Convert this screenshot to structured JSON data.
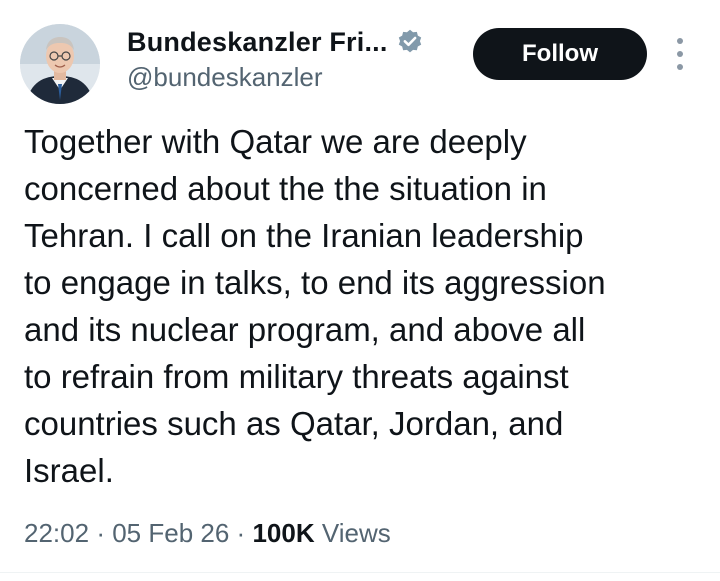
{
  "author": {
    "display_name": "Bundeskanzler Fri...",
    "handle": "@bundeskanzler",
    "verified": true,
    "verified_color": "#829aab"
  },
  "actions": {
    "follow_label": "Follow",
    "more_icon": "more-vertical-icon"
  },
  "post": {
    "text": "Together with Qatar we are deeply\nconcerned about the the situation in\nTehran. I call on the Iranian leadership\nto engage in talks, to end its aggression\nand its nuclear program, and above all\nto refrain from military threats against\ncountries such as Qatar, Jordan, and\nIsrael."
  },
  "meta": {
    "time": "22:02",
    "separator": "·",
    "date": "05 Feb 26",
    "views_count": "100K",
    "views_label": "Views"
  },
  "colors": {
    "text_primary": "#0f1419",
    "text_secondary": "#536471",
    "follow_bg": "#0f1419",
    "follow_text": "#ffffff"
  }
}
